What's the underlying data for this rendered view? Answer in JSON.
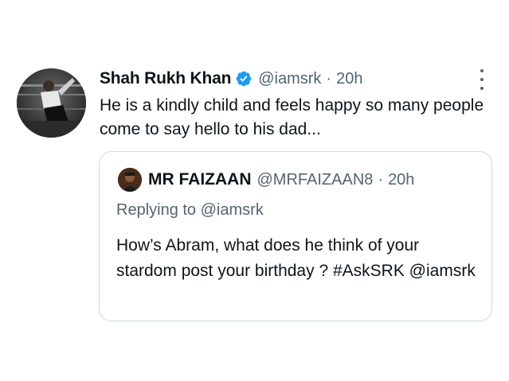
{
  "tweet": {
    "author_name": "Shah Rukh Khan",
    "handle": "@iamsrk",
    "separator": "·",
    "time": "20h",
    "text": "He is a kindly child and feels happy so many people come to say hello to his dad...",
    "verified_icon": "verified-badge-icon",
    "more_icon": "more-options-icon"
  },
  "quoted": {
    "author_name": "MR FAIZAAN",
    "handle": "@MRFAIZAAN8",
    "separator": "·",
    "time": "20h",
    "replying_prefix": "Replying to",
    "replying_handle": "@iamsrk",
    "text": "How’s Abram, what does he think of your stardom post your birthday ? #AskSRK @iamsrk"
  },
  "colors": {
    "text": "#0f1419",
    "muted": "#536471",
    "verified": "#1d9bf0",
    "border": "#cfd9de"
  }
}
